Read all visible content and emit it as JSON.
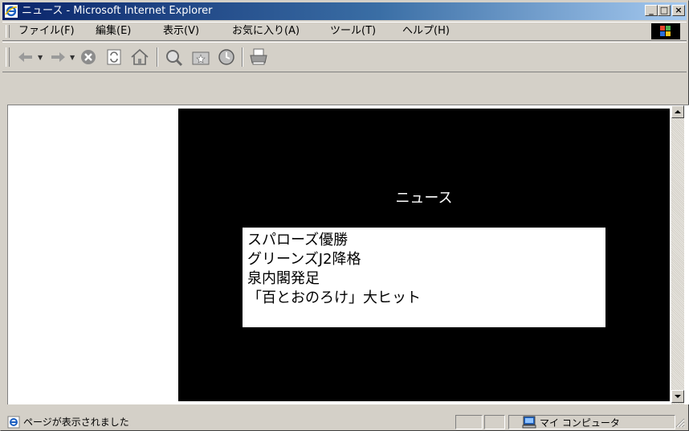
{
  "window": {
    "title": "ニュース - Microsoft Internet Explorer",
    "min_label": "_",
    "max_label": "□",
    "close_label": "×"
  },
  "menubar": {
    "items": [
      "ファイル(F)",
      "編集(E)",
      "表示(V)",
      "お気に入り(A)",
      "ツール(T)",
      "ヘルプ(H)"
    ]
  },
  "toolbar": {
    "buttons": [
      "back-icon",
      "forward-icon",
      "stop-icon",
      "refresh-icon",
      "home-icon",
      "search-icon",
      "favorites-icon",
      "history-icon",
      "print-icon"
    ]
  },
  "page": {
    "heading": "ニュース",
    "news": [
      "スパローズ優勝",
      "グリーンズJ2降格",
      "泉内閣発足",
      "「百とおのろけ」大ヒット"
    ],
    "colors": {
      "main_background": "#000000",
      "heading_text": "#ffffff",
      "list_background": "#ffffff"
    }
  },
  "statusbar": {
    "message": "ページが表示されました",
    "zone": "マイ コンピュータ"
  }
}
